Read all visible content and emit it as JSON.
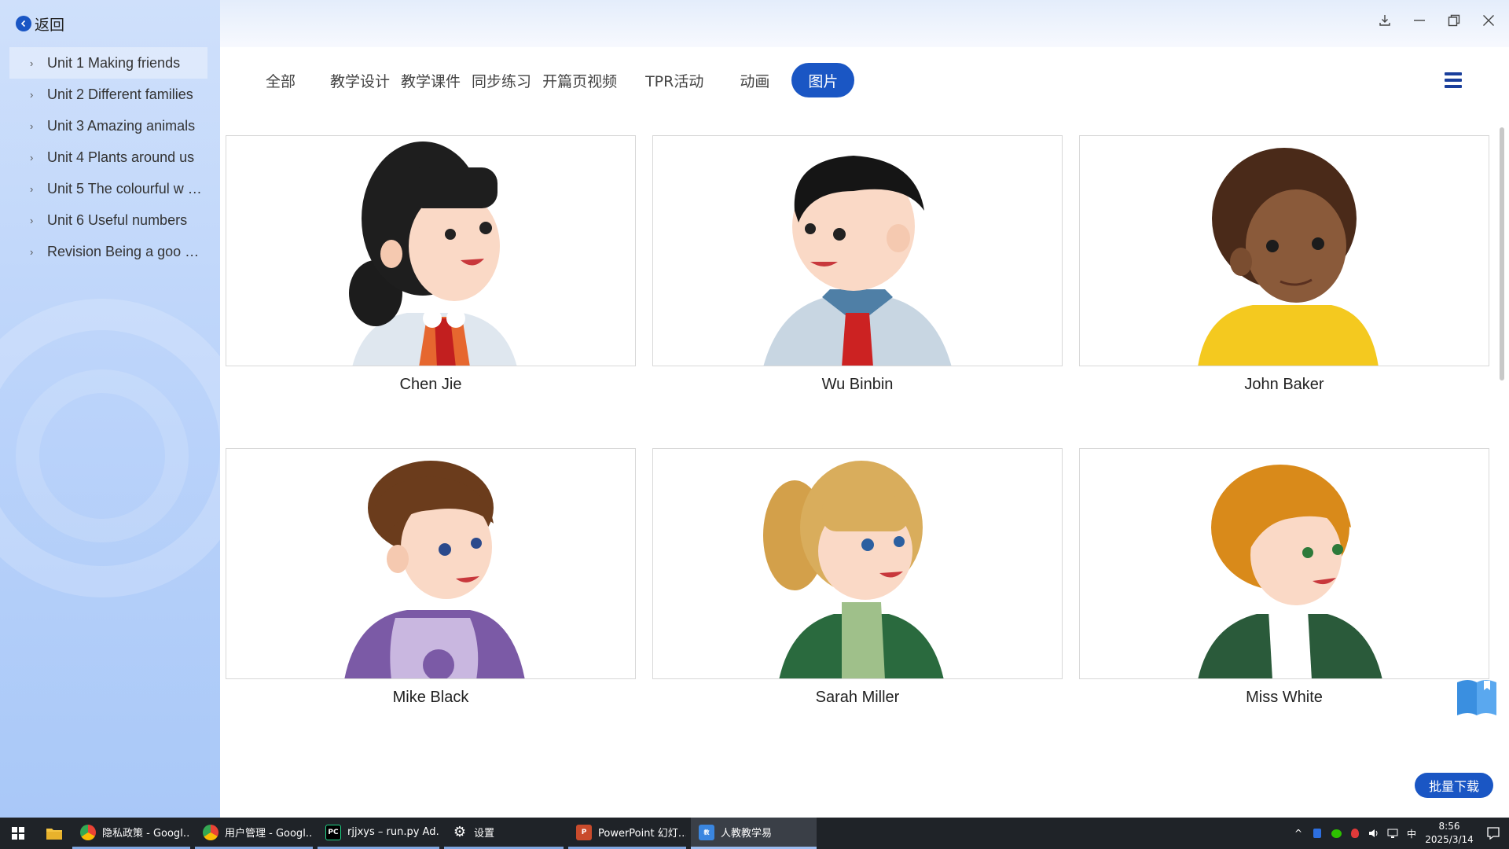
{
  "sidebar": {
    "back_label": "返回",
    "units": [
      {
        "label": "Unit 1 Making friends"
      },
      {
        "label": "Unit 2 Different families"
      },
      {
        "label": "Unit 3 Amazing animals"
      },
      {
        "label": "Unit 4 Plants around us"
      },
      {
        "label": "Unit 5 The colourful w …"
      },
      {
        "label": "Unit 6 Useful numbers"
      },
      {
        "label": "Revision Being a goo …"
      }
    ],
    "active_unit": "Unit 1 Making friends"
  },
  "tabs": [
    {
      "label": "全部"
    },
    {
      "label": "教学设计"
    },
    {
      "label": "教学课件"
    },
    {
      "label": "同步练习"
    },
    {
      "label": "开篇页视频"
    },
    {
      "label": "TPR活动"
    },
    {
      "label": "动画"
    },
    {
      "label": "图片"
    }
  ],
  "active_tab": "图片",
  "cards": [
    {
      "name": "Chen Jie"
    },
    {
      "name": "Wu Binbin"
    },
    {
      "name": "John Baker"
    },
    {
      "name": "Mike Black"
    },
    {
      "name": "Sarah Miller"
    },
    {
      "name": "Miss White"
    }
  ],
  "batch_download_label": "批量下载",
  "taskbar": {
    "tasks": [
      {
        "label": "隐私政策 - Googl…",
        "icon": "chrome-icon"
      },
      {
        "label": "用户管理 - Googl…",
        "icon": "chrome-icon"
      },
      {
        "label": "rjjxys – run.py Ad…",
        "icon": "pycharm-icon"
      },
      {
        "label": "设置",
        "icon": "gear-icon"
      },
      {
        "label": "PowerPoint 幻灯…",
        "icon": "powerpoint-icon"
      },
      {
        "label": "人教教学易",
        "icon": "app-icon"
      }
    ],
    "ime": "中",
    "time": "8:56",
    "date": "2025/3/14"
  },
  "colors": {
    "accent": "#1a56c4",
    "sidebar_top": "#cfe0fb",
    "sidebar_bottom": "#a9c8f8",
    "taskbar": "#1f2328"
  }
}
